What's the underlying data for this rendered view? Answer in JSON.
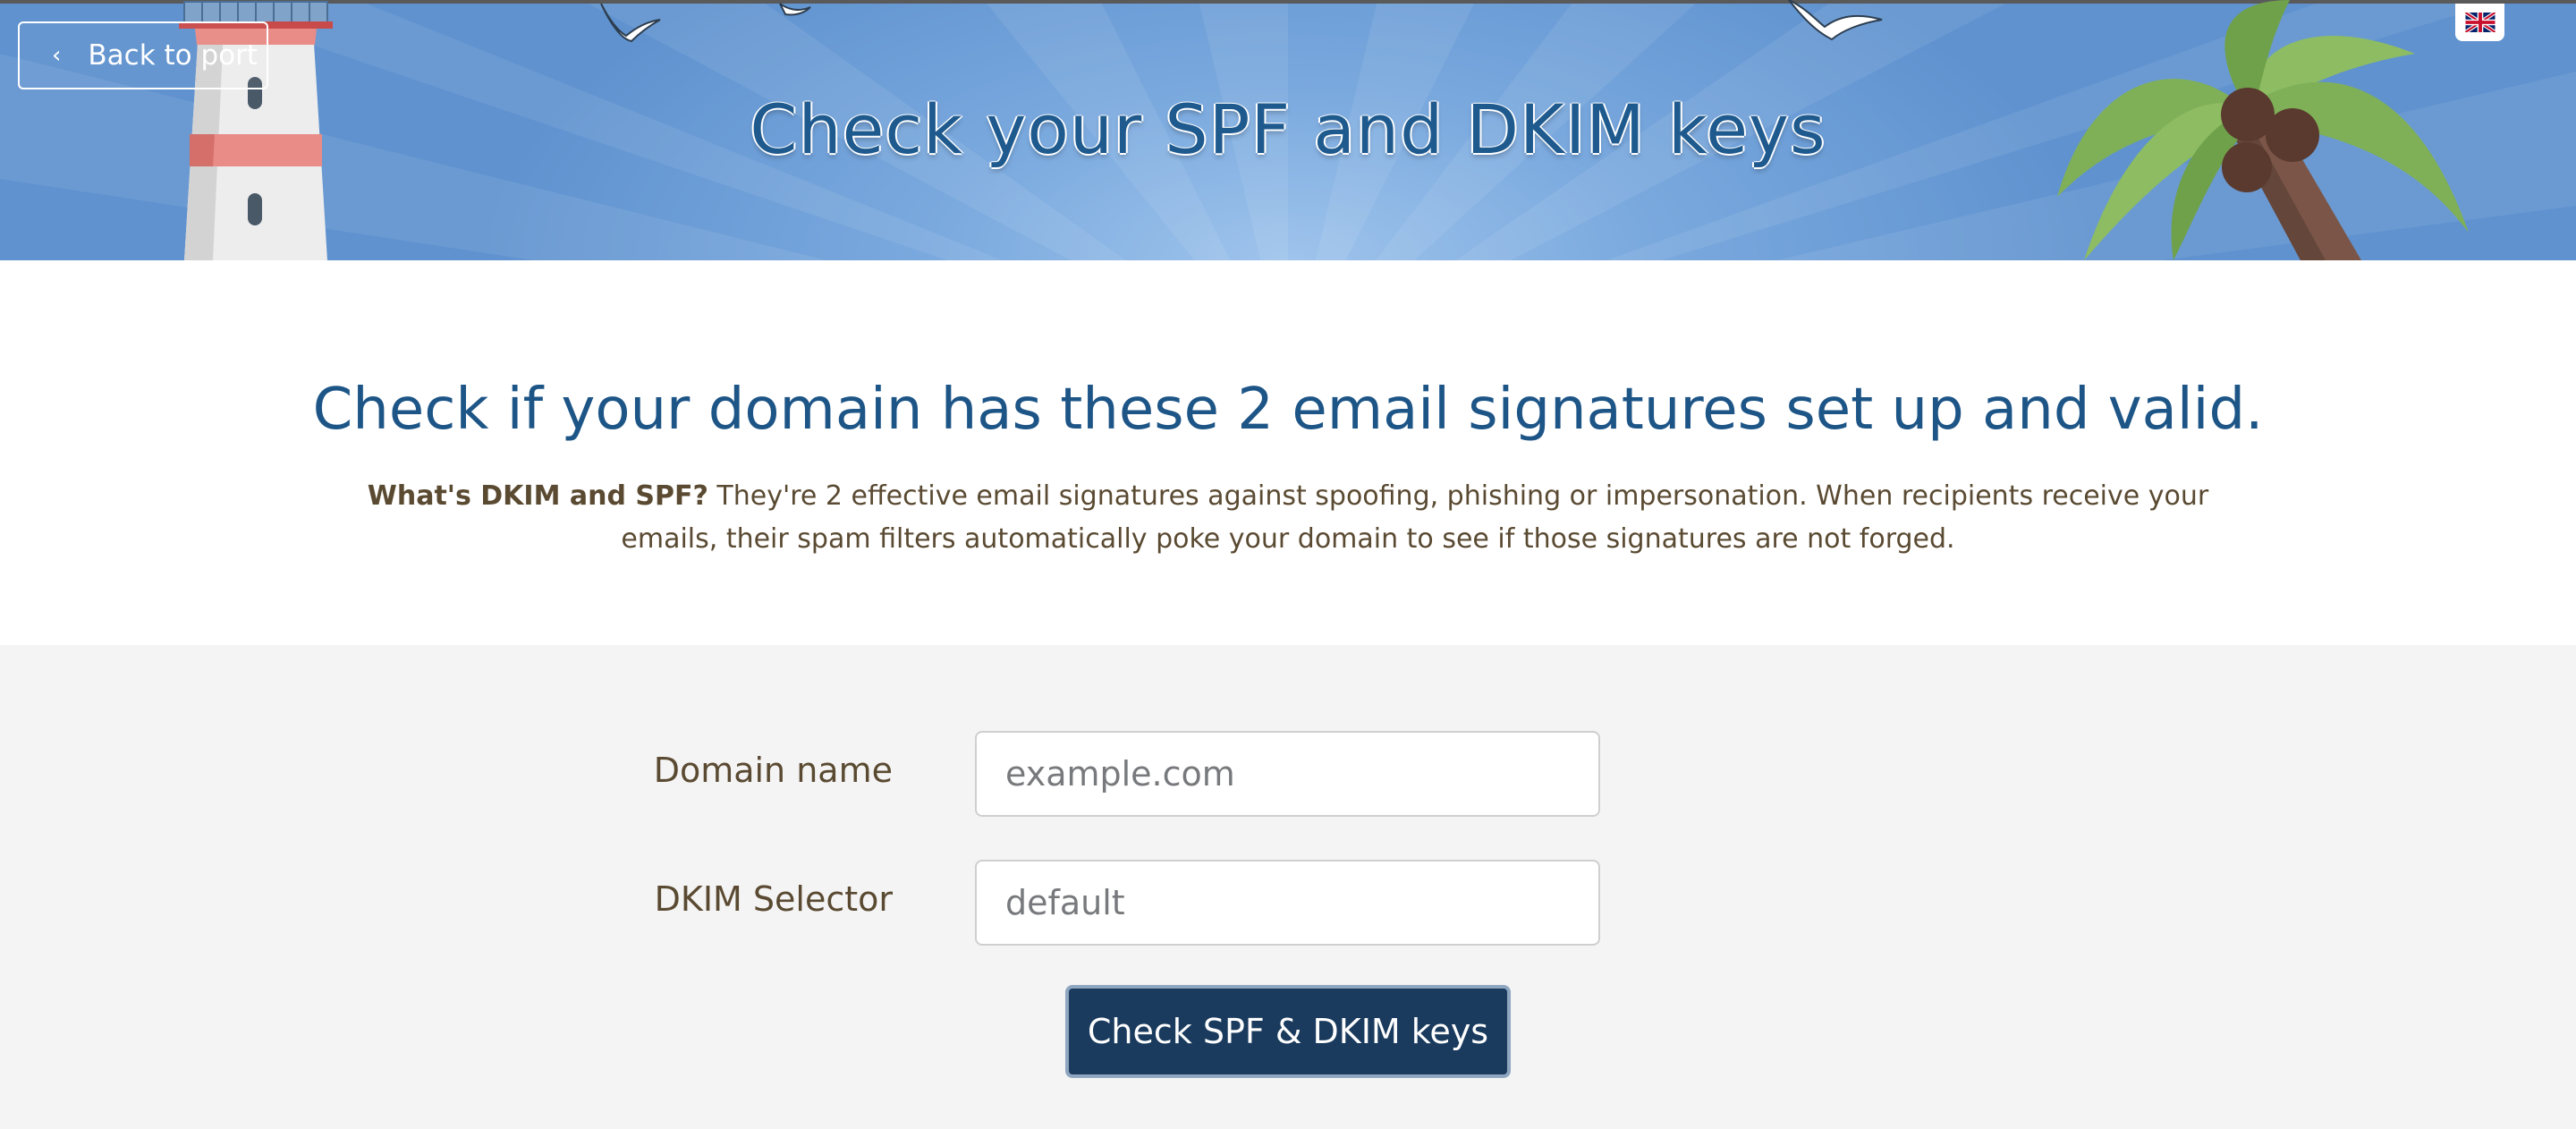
{
  "header": {
    "back_label": "Back to port",
    "back_icon": "chevron-left-icon",
    "title": "Check your SPF and DKIM keys",
    "language_icon": "uk-flag-icon"
  },
  "intro": {
    "heading": "Check if your domain has these 2 email signatures set up and valid.",
    "question": "What's DKIM and SPF?",
    "description": " They're 2 effective email signatures against spoofing, phishing or impersonation. When recipients receive your emails, their spam filters automatically poke your domain to see if those signatures are not forged."
  },
  "form": {
    "domain_label": "Domain name",
    "domain_placeholder": "example.com",
    "selector_label": "DKIM Selector",
    "selector_placeholder": "default",
    "submit_label": "Check SPF & DKIM keys"
  },
  "colors": {
    "hero_blue": "#6c9ed6",
    "title_blue": "#1f5a8e",
    "text_brown": "#5a4a32",
    "button_navy": "#1a3b5e"
  }
}
